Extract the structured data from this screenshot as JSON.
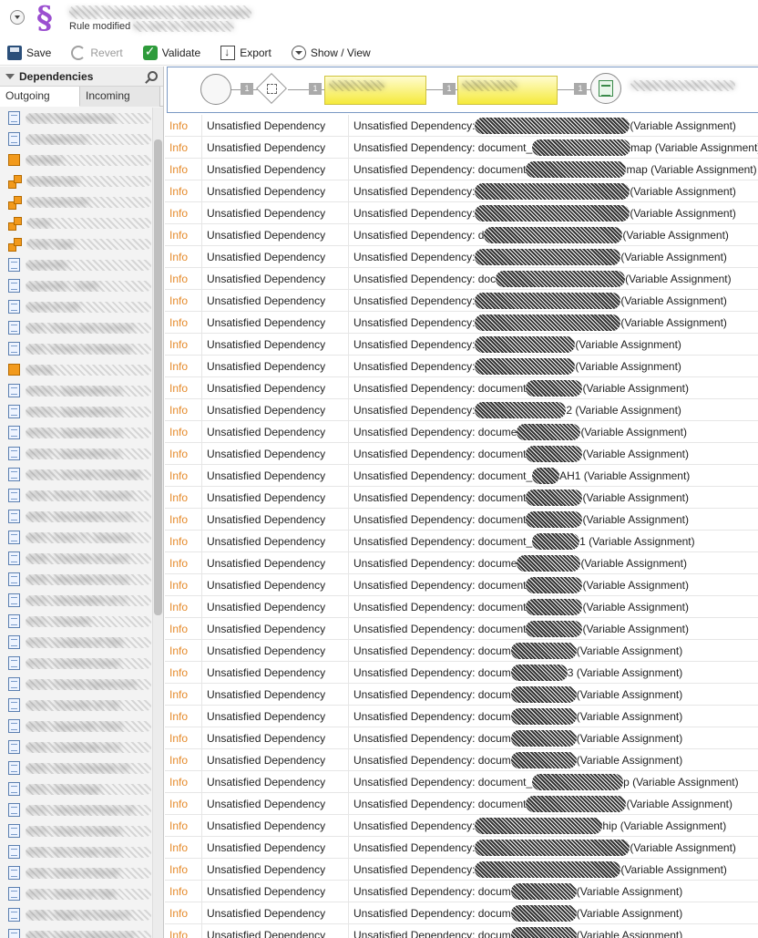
{
  "header": {
    "title": "",
    "subtitle": "Rule modified"
  },
  "toolbar": {
    "save": "Save",
    "revert": "Revert",
    "validate": "Validate",
    "export": "Export",
    "show_view": "Show / View"
  },
  "left_panel": {
    "title": "Dependencies",
    "tabs": [
      "Outgoing",
      "Incoming"
    ],
    "items": [
      {
        "icon": "document",
        "label": "W113 Transparency"
      },
      {
        "icon": "document",
        "label": "Transparency"
      },
      {
        "icon": "cube",
        "label": "Boolean"
      },
      {
        "icon": "cubes",
        "label": "Boolean-list"
      },
      {
        "icon": "cubes",
        "label": "Document-list"
      },
      {
        "icon": "cubes",
        "label": "Party"
      },
      {
        "icon": "cubes",
        "label": "Party Type"
      },
      {
        "icon": "document",
        "label": "Appendix"
      },
      {
        "icon": "document",
        "label": "Appendix - Debt"
      },
      {
        "icon": "document",
        "label": "Deed of Gift"
      },
      {
        "icon": "document",
        "label": "S02 - Form and Content"
      },
      {
        "icon": "document",
        "label": "S02 - Power of Attorney"
      },
      {
        "icon": "cube",
        "label": "String"
      },
      {
        "icon": "document",
        "label": "W01U - Application to"
      },
      {
        "icon": "document",
        "label": "W01U - Application to"
      },
      {
        "icon": "document",
        "label": "W01U - Application to"
      },
      {
        "icon": "document",
        "label": "W01T - Application to"
      },
      {
        "icon": "document",
        "label": "W01U - Annual Certificate"
      },
      {
        "icon": "document",
        "label": "W03 - Form A - Transfer"
      },
      {
        "icon": "document",
        "label": "W05 - Declaration Conc"
      },
      {
        "icon": "document",
        "label": "W07 - Form T - Declara"
      },
      {
        "icon": "document",
        "label": "W08 - Transfer of Land"
      },
      {
        "icon": "document",
        "label": "W09 - Mandate for Pay"
      },
      {
        "icon": "document",
        "label": "W10 - Declaration of S"
      },
      {
        "icon": "document",
        "label": "W11 - Transfer"
      },
      {
        "icon": "document",
        "label": "W12 - Lodging of Title"
      },
      {
        "icon": "document",
        "label": "W13 - Certified Deed"
      },
      {
        "icon": "document",
        "label": "W13 - Family Agreement"
      },
      {
        "icon": "document",
        "label": "W14 - Transfer of Titl"
      },
      {
        "icon": "document",
        "label": "W15 - Appendix Third"
      },
      {
        "icon": "document",
        "label": "W16 - Certificate of A"
      },
      {
        "icon": "document",
        "label": "W20 - Fee Schedule M"
      },
      {
        "icon": "document",
        "label": "W21 - Discharge"
      },
      {
        "icon": "document",
        "label": "W22 - General Power of"
      },
      {
        "icon": "document",
        "label": "W24 - Grant of Admin"
      },
      {
        "icon": "document",
        "label": "W25 - EU Power of A"
      },
      {
        "icon": "document",
        "label": "W26 - Deed of Rectif"
      },
      {
        "icon": "document",
        "label": "W27 - Notice of Title"
      },
      {
        "icon": "document",
        "label": "W28 - Right of Consent"
      },
      {
        "icon": "document",
        "label": "W29 - Lease Agreement"
      }
    ]
  },
  "diagram": {
    "badges": [
      "1",
      "1",
      "1",
      "1"
    ]
  },
  "grid": {
    "rows": [
      {
        "sev": "Info",
        "type": "Unsatisfied Dependency",
        "pre": "Unsatisfied Dependency:",
        "post": "(Variable Assignment)",
        "w": 170
      },
      {
        "sev": "Info",
        "type": "Unsatisfied Dependency",
        "pre": "Unsatisfied Dependency: document_",
        "post": "map (Variable Assignment)",
        "w": 108
      },
      {
        "sev": "Info",
        "type": "Unsatisfied Dependency",
        "pre": "Unsatisfied Dependency: document",
        "post": "map (Variable Assignment)",
        "w": 110
      },
      {
        "sev": "Info",
        "type": "Unsatisfied Dependency",
        "pre": "Unsatisfied Dependency:",
        "post": "(Variable Assignment)",
        "w": 170
      },
      {
        "sev": "Info",
        "type": "Unsatisfied Dependency",
        "pre": "Unsatisfied Dependency:",
        "post": "(Variable Assignment)",
        "w": 170
      },
      {
        "sev": "Info",
        "type": "Unsatisfied Dependency",
        "pre": "Unsatisfied Dependency: d",
        "post": "(Variable Assignment)",
        "w": 152
      },
      {
        "sev": "Info",
        "type": "Unsatisfied Dependency",
        "pre": "Unsatisfied Dependency:",
        "post": "(Variable Assignment)",
        "w": 160
      },
      {
        "sev": "Info",
        "type": "Unsatisfied Dependency",
        "pre": "Unsatisfied Dependency: doc",
        "post": "(Variable Assignment)",
        "w": 142
      },
      {
        "sev": "Info",
        "type": "Unsatisfied Dependency",
        "pre": "Unsatisfied Dependency:",
        "post": "(Variable Assignment)",
        "w": 160
      },
      {
        "sev": "Info",
        "type": "Unsatisfied Dependency",
        "pre": "Unsatisfied Dependency:",
        "post": "(Variable Assignment)",
        "w": 160
      },
      {
        "sev": "Info",
        "type": "Unsatisfied Dependency",
        "pre": "Unsatisfied Dependency:",
        "post": "(Variable Assignment)",
        "w": 110
      },
      {
        "sev": "Info",
        "type": "Unsatisfied Dependency",
        "pre": "Unsatisfied Dependency:",
        "post": "(Variable Assignment)",
        "w": 110
      },
      {
        "sev": "Info",
        "type": "Unsatisfied Dependency",
        "pre": "Unsatisfied Dependency: document",
        "post": "(Variable Assignment)",
        "w": 62
      },
      {
        "sev": "Info",
        "type": "Unsatisfied Dependency",
        "pre": "Unsatisfied Dependency:",
        "post": "2 (Variable Assignment)",
        "w": 100
      },
      {
        "sev": "Info",
        "type": "Unsatisfied Dependency",
        "pre": "Unsatisfied Dependency: docume",
        "post": "(Variable Assignment)",
        "w": 70
      },
      {
        "sev": "Info",
        "type": "Unsatisfied Dependency",
        "pre": "Unsatisfied Dependency: document",
        "post": "(Variable Assignment)",
        "w": 62
      },
      {
        "sev": "Info",
        "type": "Unsatisfied Dependency",
        "pre": "Unsatisfied Dependency: document_",
        "post": "AH1 (Variable Assignment)",
        "w": 30
      },
      {
        "sev": "Info",
        "type": "Unsatisfied Dependency",
        "pre": "Unsatisfied Dependency: document",
        "post": "(Variable Assignment)",
        "w": 62
      },
      {
        "sev": "Info",
        "type": "Unsatisfied Dependency",
        "pre": "Unsatisfied Dependency: document",
        "post": "(Variable Assignment)",
        "w": 62
      },
      {
        "sev": "Info",
        "type": "Unsatisfied Dependency",
        "pre": "Unsatisfied Dependency: document_",
        "post": "1 (Variable Assignment)",
        "w": 52
      },
      {
        "sev": "Info",
        "type": "Unsatisfied Dependency",
        "pre": "Unsatisfied Dependency: docume",
        "post": "(Variable Assignment)",
        "w": 70
      },
      {
        "sev": "Info",
        "type": "Unsatisfied Dependency",
        "pre": "Unsatisfied Dependency: document",
        "post": "(Variable Assignment)",
        "w": 62
      },
      {
        "sev": "Info",
        "type": "Unsatisfied Dependency",
        "pre": "Unsatisfied Dependency: document",
        "post": "(Variable Assignment)",
        "w": 62
      },
      {
        "sev": "Info",
        "type": "Unsatisfied Dependency",
        "pre": "Unsatisfied Dependency: document",
        "post": "(Variable Assignment)",
        "w": 62
      },
      {
        "sev": "Info",
        "type": "Unsatisfied Dependency",
        "pre": "Unsatisfied Dependency: docum",
        "post": "(Variable Assignment)",
        "w": 72
      },
      {
        "sev": "Info",
        "type": "Unsatisfied Dependency",
        "pre": "Unsatisfied Dependency: docum",
        "post": "3 (Variable Assignment)",
        "w": 62
      },
      {
        "sev": "Info",
        "type": "Unsatisfied Dependency",
        "pre": "Unsatisfied Dependency: docum",
        "post": "(Variable Assignment)",
        "w": 72
      },
      {
        "sev": "Info",
        "type": "Unsatisfied Dependency",
        "pre": "Unsatisfied Dependency: docum",
        "post": "(Variable Assignment)",
        "w": 72
      },
      {
        "sev": "Info",
        "type": "Unsatisfied Dependency",
        "pre": "Unsatisfied Dependency: docum",
        "post": "(Variable Assignment)",
        "w": 72
      },
      {
        "sev": "Info",
        "type": "Unsatisfied Dependency",
        "pre": "Unsatisfied Dependency: docum",
        "post": "(Variable Assignment)",
        "w": 72
      },
      {
        "sev": "Info",
        "type": "Unsatisfied Dependency",
        "pre": "Unsatisfied Dependency: document_",
        "post": "p (Variable Assignment)",
        "w": 100
      },
      {
        "sev": "Info",
        "type": "Unsatisfied Dependency",
        "pre": "Unsatisfied Dependency: document",
        "post": "(Variable Assignment)",
        "w": 110
      },
      {
        "sev": "Info",
        "type": "Unsatisfied Dependency",
        "pre": "Unsatisfied Dependency:",
        "post": "hip (Variable Assignment)",
        "w": 140
      },
      {
        "sev": "Info",
        "type": "Unsatisfied Dependency",
        "pre": "Unsatisfied Dependency:",
        "post": "(Variable Assignment)",
        "w": 170
      },
      {
        "sev": "Info",
        "type": "Unsatisfied Dependency",
        "pre": "Unsatisfied Dependency:",
        "post": "(Variable Assignment)",
        "w": 160
      },
      {
        "sev": "Info",
        "type": "Unsatisfied Dependency",
        "pre": "Unsatisfied Dependency: docum",
        "post": "(Variable Assignment)",
        "w": 72
      },
      {
        "sev": "Info",
        "type": "Unsatisfied Dependency",
        "pre": "Unsatisfied Dependency: docum",
        "post": "(Variable Assignment)",
        "w": 72
      },
      {
        "sev": "Info",
        "type": "Unsatisfied Dependency",
        "pre": "Unsatisfied Dependency: docum",
        "post": "(Variable Assignment)",
        "w": 72
      }
    ]
  }
}
